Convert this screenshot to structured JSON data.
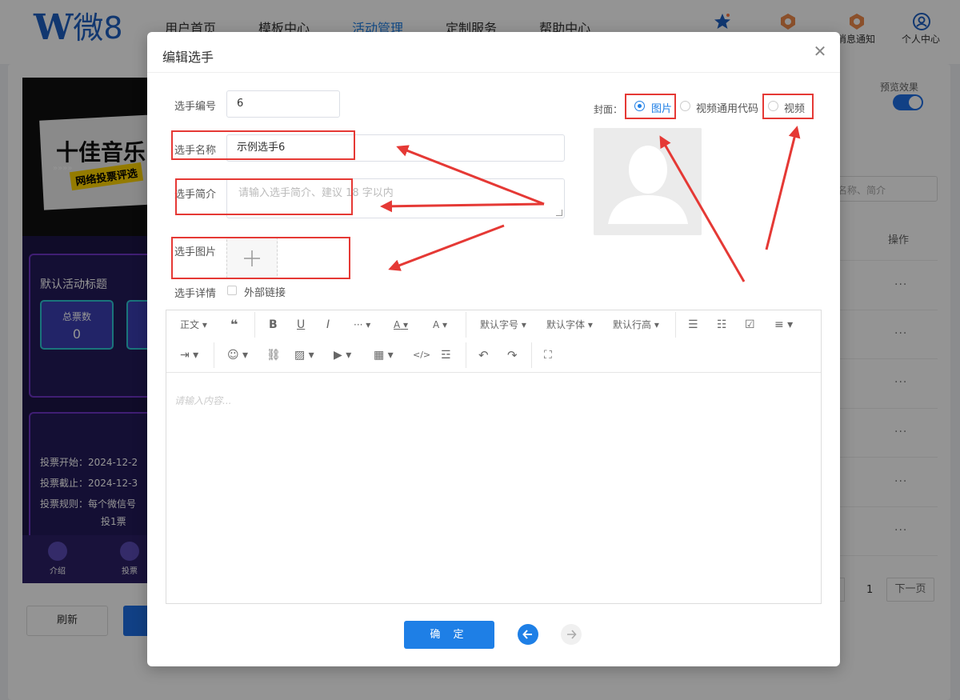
{
  "nav": {
    "logo": "微8",
    "links": [
      "用户首页",
      "模板中心",
      "活动管理",
      "定制服务",
      "帮助中心"
    ],
    "active_index": 2,
    "right_labels": {
      "messages": "消息通知",
      "profile": "个人中心"
    }
  },
  "background": {
    "phone": {
      "banner_title": "十佳音乐",
      "banner_subtitle": "网络投票评选",
      "banner_arrows": "»»»»",
      "card_title": "默认活动标题",
      "stat_label": "总票数",
      "stat_value": "0",
      "vote_start": "投票开始：2024-12-2",
      "vote_end": "投票截止：2024-12-3",
      "vote_rule": "投票规则：每个微信号",
      "vote_rule2": "投1票",
      "bottom_nav": [
        "介绍",
        "投票"
      ]
    },
    "preview_label": "预览效果",
    "search_placeholder": "名称、简介",
    "table_op_header": "操作",
    "row_action": "···",
    "page_number": "1",
    "next_page": "下一页",
    "refresh_button": "刷新"
  },
  "modal": {
    "title": "编辑选手",
    "fields": {
      "number_label": "选手编号",
      "number_value": "6",
      "name_label": "选手名称",
      "name_value": "示例选手6",
      "intro_label": "选手简介",
      "intro_placeholder": "请输入选手简介、建议 18 字以内",
      "image_label": "选手图片",
      "detail_label": "选手详情",
      "external_link_label": "外部链接"
    },
    "cover": {
      "label": "封面：",
      "options": [
        "图片",
        "视频通用代码",
        "视频"
      ],
      "selected_index": 0
    },
    "editor": {
      "toolbar_row1": [
        "正文",
        "❝",
        "B",
        "U",
        "I",
        "···",
        "A",
        "A",
        "默认字号",
        "默认字体",
        "默认行高"
      ],
      "placeholder": "请输入内容..."
    },
    "confirm_button": "确 定"
  },
  "colors": {
    "primary": "#1e7fe6",
    "annotation_red": "#e53935",
    "overlay": "rgba(0,0,0,0.42)"
  }
}
